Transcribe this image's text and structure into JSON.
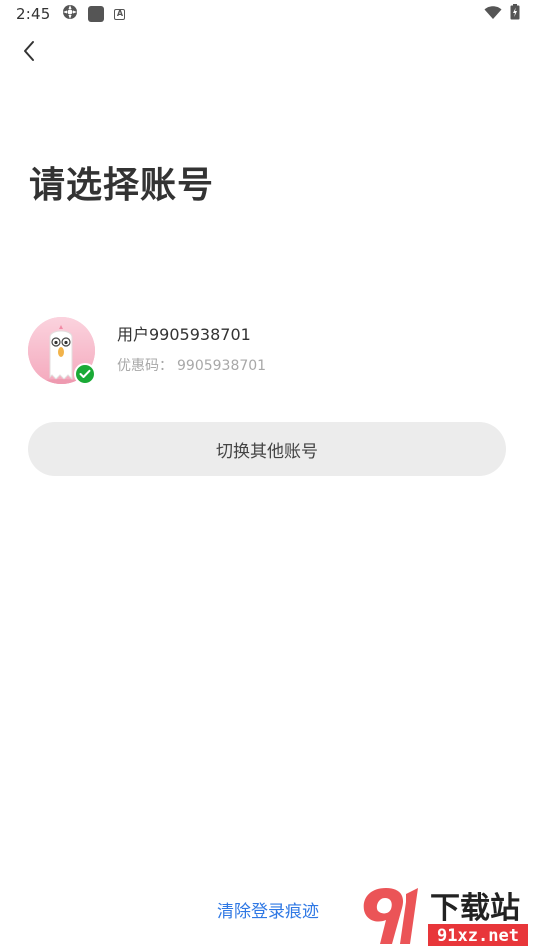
{
  "status_bar": {
    "time": "2:45",
    "icons_left": [
      "settings-icon",
      "app-square-icon",
      "keyboard-a-icon"
    ],
    "icons_right": [
      "wifi-icon",
      "battery-icon"
    ]
  },
  "header": {
    "back_icon": "chevron-left-icon"
  },
  "page": {
    "title": "请选择账号"
  },
  "account": {
    "name": "用户9905938701",
    "promo_label": "优惠码：",
    "promo_value": "9905938701",
    "selected": true
  },
  "actions": {
    "switch_label": "切换其他账号",
    "clear_label": "清除登录痕迹"
  },
  "watermark": {
    "logo_text": "下载站",
    "site": "91xz.net"
  },
  "colors": {
    "link": "#2f78e4",
    "check": "#1aaa36",
    "button_bg": "#ececec",
    "watermark_red": "#e8363a"
  }
}
